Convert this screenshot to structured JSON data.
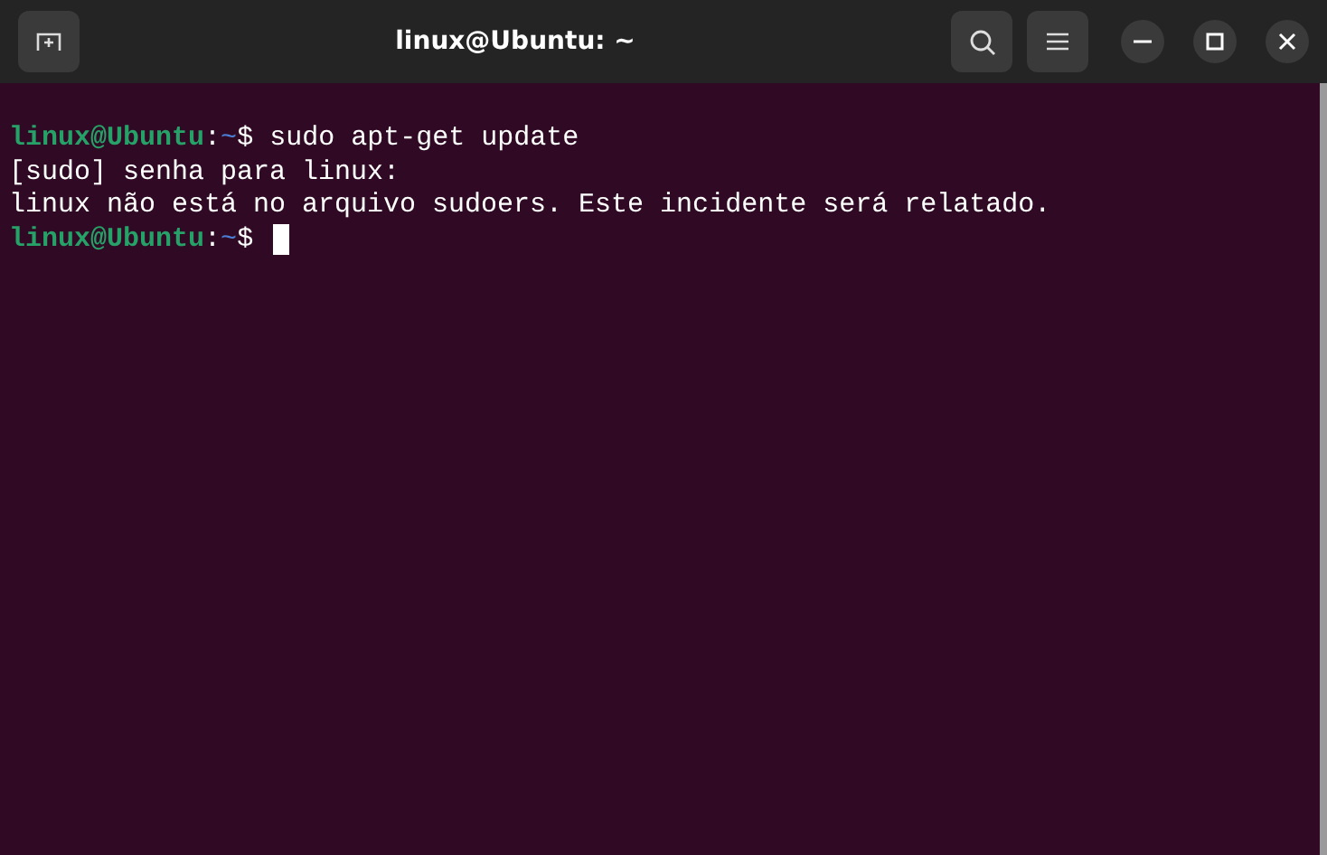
{
  "window": {
    "title": "linux@Ubuntu: ~"
  },
  "terminal": {
    "lines": [
      {
        "kind": "prompt",
        "user": "linux@Ubuntu",
        "separator": ":",
        "path": "~",
        "symbol": "$",
        "command": "sudo apt-get update",
        "cursor": false
      },
      {
        "kind": "output",
        "text": "[sudo] senha para linux:"
      },
      {
        "kind": "output",
        "text": "linux não está no arquivo sudoers. Este incidente será relatado."
      },
      {
        "kind": "prompt",
        "user": "linux@Ubuntu",
        "separator": ":",
        "path": "~",
        "symbol": "$",
        "cursor": true
      }
    ]
  }
}
